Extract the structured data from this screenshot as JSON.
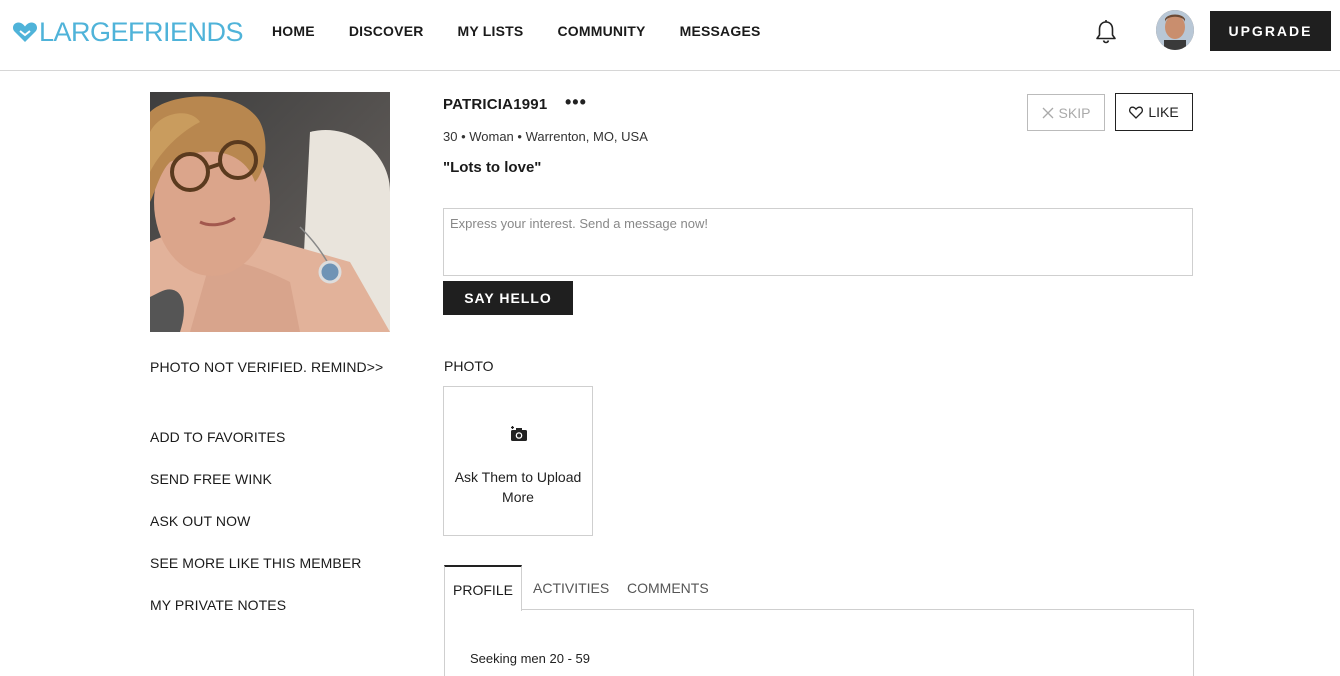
{
  "header": {
    "logo_text": "LARGEFRIENDS",
    "brand_color": "#4fb3d9",
    "nav": [
      "HOME",
      "DISCOVER",
      "MY LISTS",
      "COMMUNITY",
      "MESSAGES"
    ],
    "upgrade_label": "UPGRADE",
    "icons": [
      "heart-logo-icon",
      "bell-icon",
      "user-avatar"
    ]
  },
  "sidebar": {
    "photo_verification": "PHOTO NOT VERIFIED. REMIND>>",
    "links": [
      "ADD TO FAVORITES",
      "SEND FREE WINK",
      "ASK OUT NOW",
      "SEE MORE LIKE THIS MEMBER",
      "MY PRIVATE NOTES"
    ]
  },
  "profile": {
    "username": "PATRICIA1991",
    "more_label": "•••",
    "details": "30 • Woman • Warrenton, MO, USA",
    "tagline": "\"Lots to love\"",
    "skip_label": "SKIP",
    "like_label": "LIKE"
  },
  "message": {
    "placeholder": "Express your interest. Send a message now!",
    "send_label": "SAY HELLO"
  },
  "photos": {
    "section_label": "PHOTO",
    "upload_prompt": "Ask Them to Upload More"
  },
  "tabs": [
    "PROFILE",
    "ACTIVITIES",
    "COMMENTS"
  ],
  "profile_tab": {
    "seeking": "Seeking men 20 - 59"
  }
}
